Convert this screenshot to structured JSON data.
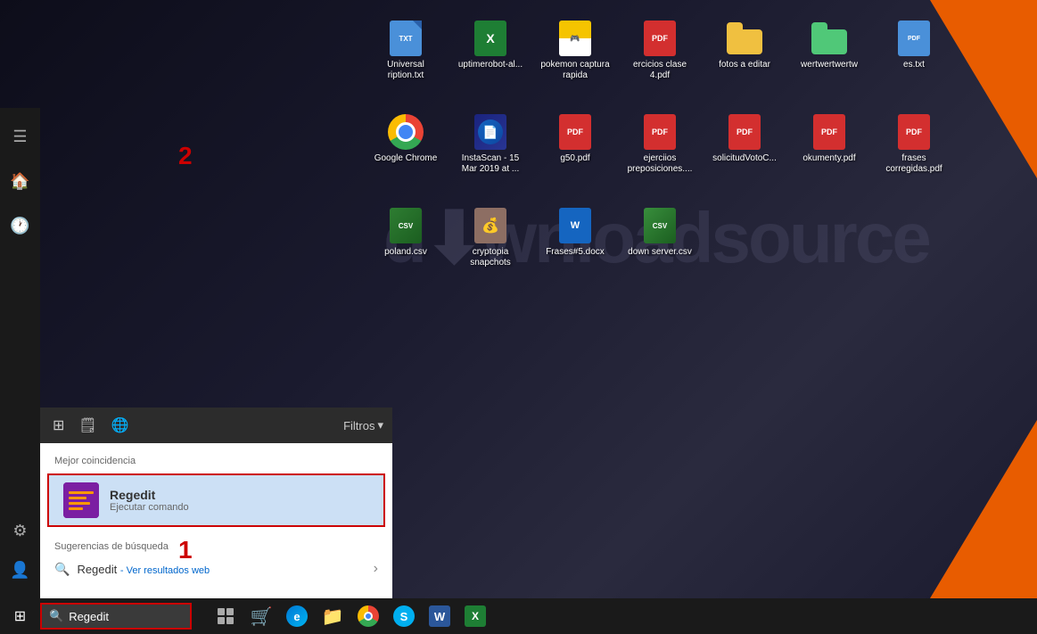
{
  "desktop": {
    "bg_color": "#1a1a2e",
    "icons": [
      {
        "label": "Universal ription.txt",
        "type": "txt",
        "id": "universal-txt"
      },
      {
        "label": "uptimerobot-al...",
        "type": "excel",
        "id": "uptimerobot"
      },
      {
        "label": "pokemon captura rapida",
        "type": "pokemon",
        "id": "pokemon"
      },
      {
        "label": "ercicios clase 4.pdf",
        "type": "pdf",
        "id": "ejercicios-clase4"
      },
      {
        "label": "fotos a editar",
        "type": "folder",
        "id": "fotos-editar"
      },
      {
        "label": "wertwertwertw",
        "type": "folder2",
        "id": "wertwertwertw"
      },
      {
        "label": "es.txt",
        "type": "txt",
        "id": "es-txt"
      },
      {
        "label": "Google Chrome",
        "type": "chrome",
        "id": "google-chrome"
      },
      {
        "label": "InstaScan - 15 Mar 2019 at ...",
        "type": "instascan",
        "id": "instascan"
      },
      {
        "label": "g50.pdf",
        "type": "pdf",
        "id": "g50"
      },
      {
        "label": "ejerciios preposiciones....",
        "type": "pdf",
        "id": "ejerciios"
      },
      {
        "label": "solicitudVotoC...",
        "type": "pdf",
        "id": "solicitudvotoc"
      },
      {
        "label": "okumenty.pdf",
        "type": "pdf",
        "id": "okumenty"
      },
      {
        "label": "frases corregidas.pdf",
        "type": "pdf",
        "id": "frases-corregidas"
      },
      {
        "label": "poland.csv",
        "type": "csv",
        "id": "poland-csv"
      },
      {
        "label": "cryptopia snapchots",
        "type": "cryptopia",
        "id": "cryptopia"
      },
      {
        "label": "Frases#5.docx",
        "type": "docx",
        "id": "frases5"
      },
      {
        "label": "down server.csv",
        "type": "csv2",
        "id": "down-server"
      }
    ]
  },
  "start_menu": {
    "toolbar": {
      "icons": [
        "≡",
        "🗒",
        "🌐"
      ],
      "filters_label": "Filtros"
    },
    "best_match_label": "Mejor coincidencia",
    "best_match": {
      "title": "Regedit",
      "subtitle": "Ejecutar comando"
    },
    "suggestions_label": "Sugerencias de búsqueda",
    "suggestion": {
      "text": "Regedit",
      "link_text": "- Ver resultados web"
    },
    "annotation_1": "1",
    "annotation_2": "2"
  },
  "taskbar": {
    "start_icon": "⊞",
    "search_text": "Regedit",
    "search_placeholder": "Regedit",
    "apps": [
      "⬜",
      "🛒",
      "e",
      "📁",
      "🌐",
      "💬",
      "W",
      "X"
    ]
  }
}
